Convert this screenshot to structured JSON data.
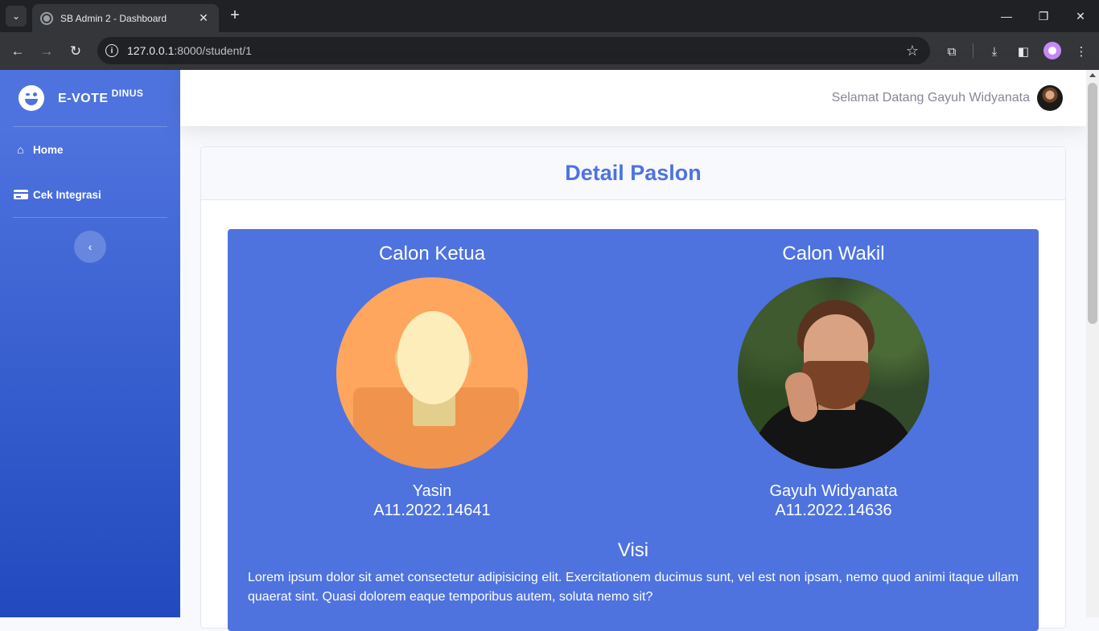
{
  "browser": {
    "tab_title": "SB Admin 2 - Dashboard",
    "url_host": "127.0.0.1",
    "url_path": ":8000/student/1"
  },
  "sidebar": {
    "brand": "E-VOTE",
    "brand_sup": "DINUS",
    "items": [
      {
        "label": "Home",
        "icon": "home-icon"
      },
      {
        "label": "Cek Integrasi",
        "icon": "id-card-icon"
      }
    ]
  },
  "topbar": {
    "welcome": "Selamat Datang Gayuh Widyanata"
  },
  "card": {
    "title": "Detail Paslon"
  },
  "paslon": {
    "ketua": {
      "heading": "Calon Ketua",
      "name": "Yasin",
      "nim": "A11.2022.14641"
    },
    "wakil": {
      "heading": "Calon Wakil",
      "name": "Gayuh Widyanata",
      "nim": "A11.2022.14636"
    }
  },
  "visi": {
    "title": "Visi",
    "text": "Lorem ipsum dolor sit amet consectetur adipisicing elit. Exercitationem ducimus sunt, vel est non ipsam, nemo quod animi itaque ullam quaerat sint. Quasi dolorem eaque temporibus autem, soluta nemo sit?"
  },
  "colors": {
    "primary": "#4e73df",
    "sidebar_end": "#224abe",
    "text_muted": "#858796"
  }
}
